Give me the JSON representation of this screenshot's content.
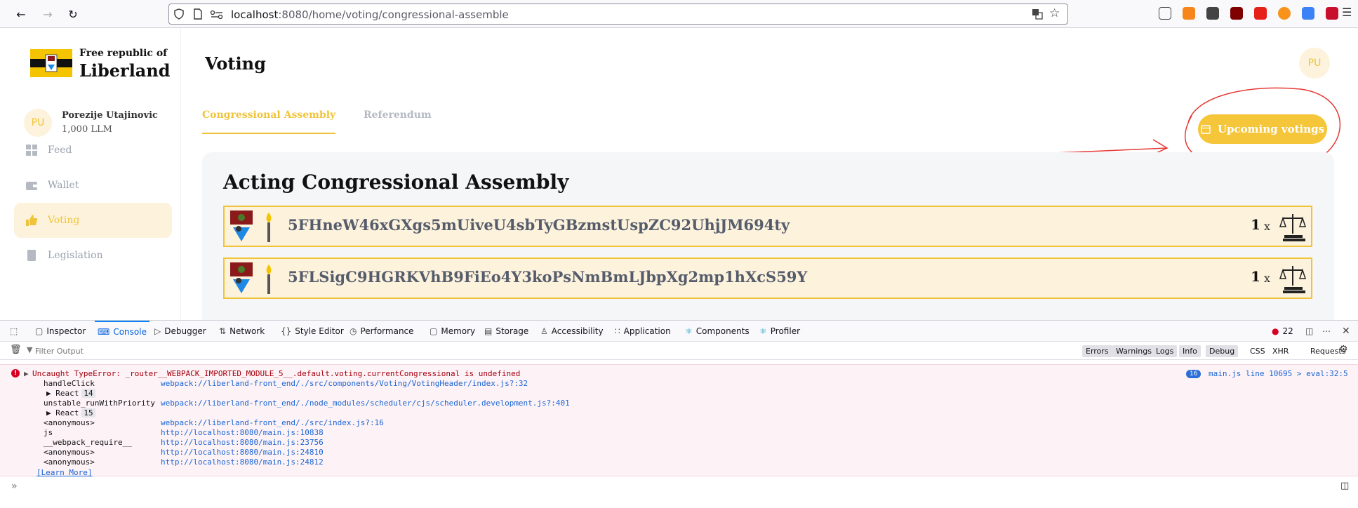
{
  "browser": {
    "url_host": "localhost",
    "url_rest": ":8080/home/voting/congressional-assemble"
  },
  "sidebar": {
    "logo_small": "Free republic of",
    "logo_big": "Liberland",
    "user_initials": "PU",
    "user_name": "Porezije Utajinovic",
    "user_balance": "1,000 LLM",
    "items": [
      {
        "label": "Feed",
        "icon": "grid-icon"
      },
      {
        "label": "Wallet",
        "icon": "wallet-icon"
      },
      {
        "label": "Voting",
        "icon": "thumbs-up-icon",
        "active": true
      },
      {
        "label": "Legislation",
        "icon": "book-icon"
      }
    ]
  },
  "header": {
    "title": "Voting",
    "avatar_initials": "PU"
  },
  "tabs": [
    {
      "label": "Congressional Assembly",
      "active": true
    },
    {
      "label": "Referendum",
      "active": false
    }
  ],
  "upcoming_button": "Upcoming votings",
  "card": {
    "title": "Acting Congressional Assembly",
    "candidates": [
      {
        "address": "5FHneW46xGXgs5mUiveU4sbTyGBzmstUspZC92UhjJM694ty",
        "count": "1",
        "x": "x"
      },
      {
        "address": "5FLSigC9HGRKVhB9FiEo4Y3koPsNmBmLJbpXg2mp1hXcS59Y",
        "count": "1",
        "x": "x"
      }
    ]
  },
  "devtools": {
    "tabs": [
      "Inspector",
      "Console",
      "Debugger",
      "Network",
      "Style Editor",
      "Performance",
      "Memory",
      "Storage",
      "Accessibility",
      "Application",
      "Components",
      "Profiler"
    ],
    "selected_tab": "Console",
    "error_count": "22",
    "filter_placeholder": "Filter Output",
    "filters": [
      "Errors",
      "Warnings",
      "Logs",
      "Info",
      "Debug"
    ],
    "extra_filters": [
      "CSS",
      "XHR",
      "Requests"
    ],
    "error_message": "Uncaught TypeError: _router__WEBPACK_IMPORTED_MODULE_5__.default.voting.currentCongressional is undefined",
    "error_repeat": "16",
    "error_location": "main.js line 10695 > eval:32:5",
    "stack": [
      {
        "fn": "handleClick",
        "src": "webpack://liberland-front_end/./src/components/Voting/VotingHeader/index.js?:32"
      },
      {
        "group": "React",
        "count": "14"
      },
      {
        "fn": "unstable_runWithPriority",
        "src": "webpack://liberland-front_end/./node_modules/scheduler/cjs/scheduler.development.js?:401"
      },
      {
        "group": "React",
        "count": "15"
      },
      {
        "fn": "<anonymous>",
        "src": "webpack://liberland-front_end/./src/index.js?:16"
      },
      {
        "fn": "js",
        "src": "http://localhost:8080/main.js:10838"
      },
      {
        "fn": "__webpack_require__",
        "src": "http://localhost:8080/main.js:23756"
      },
      {
        "fn": "<anonymous>",
        "src": "http://localhost:8080/main.js:24810"
      },
      {
        "fn": "<anonymous>",
        "src": "http://localhost:8080/main.js:24812"
      }
    ],
    "learn_more": "[Learn More]"
  },
  "colors": {
    "accent": "#f0c43a",
    "error_text": "#a4000f",
    "link": "#1a66d6"
  }
}
